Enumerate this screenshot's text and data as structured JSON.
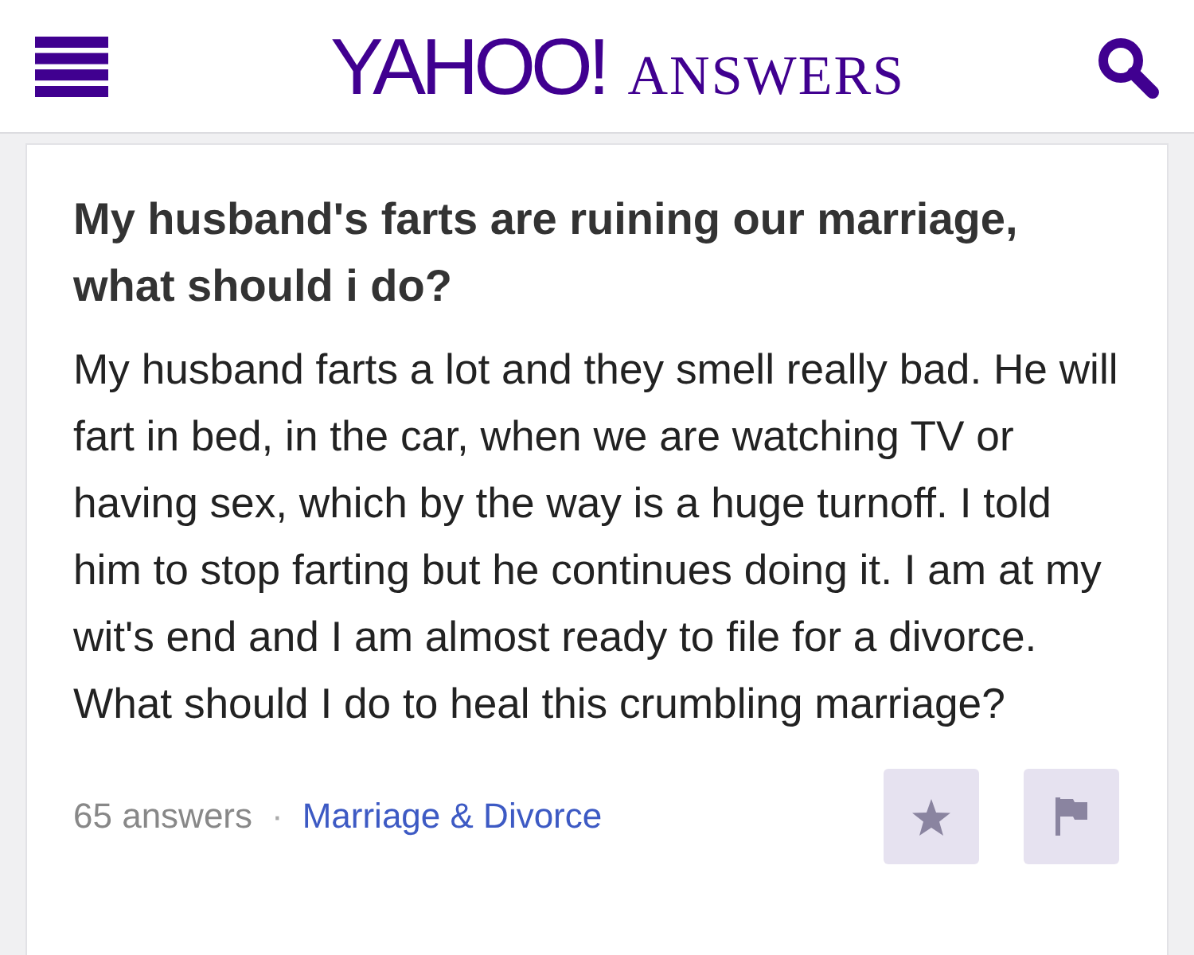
{
  "header": {
    "logo": "YAHOO!",
    "section": "ANSWERS"
  },
  "question": {
    "title": "My husband's farts are ruining our marriage, what should i do?",
    "body": "My husband farts a lot and they smell really bad. He will fart in bed, in the car, when we are watching TV or having sex, which by the way is a huge turnoff. I told him to stop farting but he continues doing it. I am at my wit's end and I am almost ready to file for a divorce. What should I do to heal this crumbling marriage?"
  },
  "footer": {
    "answer_count": "65 answers",
    "separator": "·",
    "category": "Marriage & Divorce"
  }
}
